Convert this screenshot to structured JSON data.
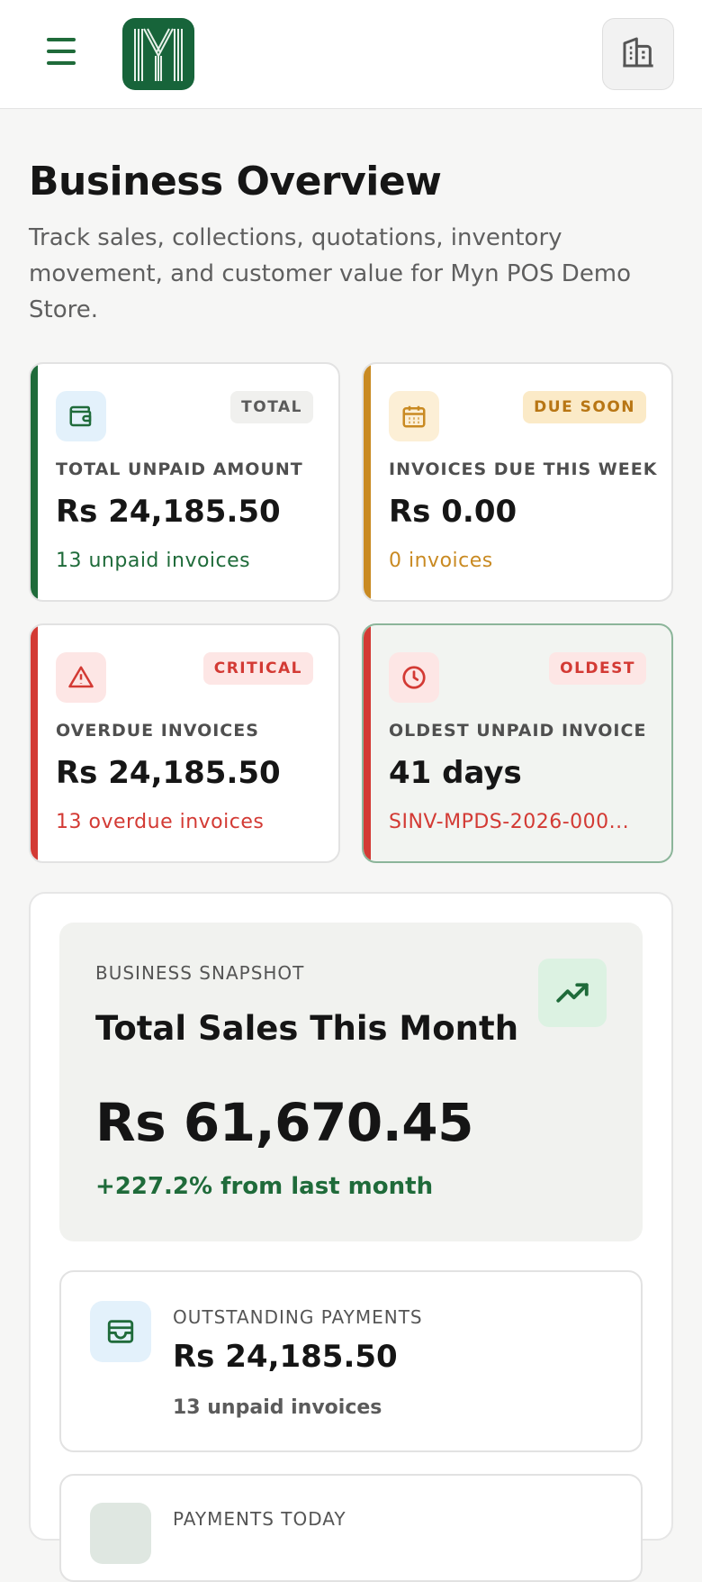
{
  "header": {
    "menu_icon": "hamburger-menu-icon",
    "logo_icon": "myn-pos-logo",
    "store_icon": "building-icon"
  },
  "page": {
    "title": "Business Overview",
    "subtitle": "Track sales, collections, quotations, inventory movement, and customer value for Myn POS Demo Store."
  },
  "cards": [
    {
      "id": "total-unpaid",
      "icon": "wallet-icon",
      "badge": "TOTAL",
      "label": "TOTAL UNPAID AMOUNT",
      "value": "Rs 24,185.50",
      "sub": "13 unpaid invoices",
      "accent": "#1f6b3a"
    },
    {
      "id": "due-this-week",
      "icon": "calendar-icon",
      "badge": "DUE SOON",
      "label": "INVOICES DUE THIS WEEK",
      "value": "Rs 0.00",
      "sub": "0 invoices",
      "accent": "#c98a22"
    },
    {
      "id": "overdue",
      "icon": "warning-triangle-icon",
      "badge": "CRITICAL",
      "label": "OVERDUE INVOICES",
      "value": "Rs 24,185.50",
      "sub": "13 overdue invoices",
      "accent": "#d33a34"
    },
    {
      "id": "oldest-unpaid",
      "icon": "clock-icon",
      "badge": "OLDEST",
      "label": "OLDEST UNPAID INVOICE",
      "value": "41 days",
      "sub": "SINV-MPDS-2026-000...",
      "accent": "#d33a34"
    }
  ],
  "snapshot": {
    "label": "BUSINESS SNAPSHOT",
    "title": "Total Sales This Month",
    "value": "Rs 61,670.45",
    "change": "+227.2% from last month",
    "icon": "trending-up-icon"
  },
  "outstanding": {
    "icon": "inbox-tray-icon",
    "label": "OUTSTANDING PAYMENTS",
    "value": "Rs 24,185.50",
    "sub": "13 unpaid invoices"
  },
  "payments_today": {
    "label": "PAYMENTS TODAY"
  },
  "colors": {
    "brand_green": "#17643a",
    "warning_amber": "#c98a22",
    "danger_red": "#d33a34"
  }
}
